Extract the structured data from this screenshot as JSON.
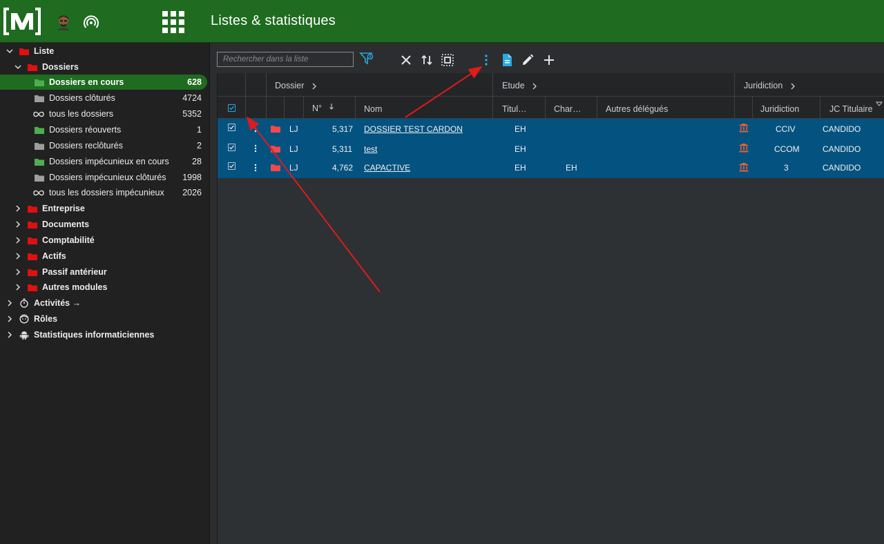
{
  "header": {
    "title": "Listes & statistiques",
    "brand_color": "#1f6b1f"
  },
  "sidebar": {
    "root": {
      "label": "Liste"
    },
    "dossiers": {
      "label": "Dossiers",
      "items": [
        {
          "label": "Dossiers en cours",
          "count": "628",
          "icon": "folder-green",
          "selected": true
        },
        {
          "label": "Dossiers clôturés",
          "count": "4724",
          "icon": "folder-gray"
        },
        {
          "label": "tous les dossiers",
          "count": "5352",
          "icon": "infinity-icon"
        },
        {
          "label": "Dossiers réouverts",
          "count": "1",
          "icon": "folder-green"
        },
        {
          "label": "Dossiers reclôturés",
          "count": "2",
          "icon": "folder-gray"
        },
        {
          "label": "Dossiers impécunieux en cours",
          "count": "28",
          "icon": "folder-green"
        },
        {
          "label": "Dossiers impécunieux clôturés",
          "count": "1998",
          "icon": "folder-gray"
        },
        {
          "label": "tous les dossiers impécunieux",
          "count": "2026",
          "icon": "infinity-icon"
        }
      ]
    },
    "modules": [
      {
        "label": "Entreprise"
      },
      {
        "label": "Documents"
      },
      {
        "label": "Comptabilité"
      },
      {
        "label": "Actifs"
      },
      {
        "label": "Passif antérieur"
      },
      {
        "label": "Autres modules"
      }
    ],
    "sections": [
      {
        "label": "Activités →",
        "icon": "stopwatch-icon"
      },
      {
        "label": "Rôles",
        "icon": "face-icon"
      },
      {
        "label": "Statistiques informaticiennes",
        "icon": "android-icon"
      }
    ]
  },
  "toolbar": {
    "search_placeholder": "Rechercher dans la liste",
    "icons": [
      "filter-icon",
      "clear-icon",
      "sort-icon",
      "select-all-icon",
      "more-vert-icon",
      "document-icon",
      "edit-icon",
      "add-icon"
    ]
  },
  "table": {
    "groups": [
      "Dossier",
      "Etude",
      "Juridiction"
    ],
    "columns": {
      "numero": "N°",
      "nom": "Nom",
      "titulaire": "Titul…",
      "charge": "Char…",
      "autres": "Autres délégués",
      "juridiction": "Juridiction",
      "jc_titulaire": "JC Titulaire"
    },
    "rows": [
      {
        "type": "LJ",
        "numero": "5,317",
        "nom": "DOSSIER TEST CARDON",
        "titulaire": "EH",
        "charge": "",
        "juridiction": "CCIV",
        "jc": "CANDIDO"
      },
      {
        "type": "LJ",
        "numero": "5,311",
        "nom": "test",
        "titulaire": "EH",
        "charge": "",
        "juridiction": "CCOM",
        "jc": "CANDIDO"
      },
      {
        "type": "LJ",
        "numero": "4,762",
        "nom": "CAPACTIVE",
        "titulaire": "EH",
        "charge": "EH",
        "juridiction": "3",
        "jc": "CANDIDO"
      }
    ],
    "row_color": "#045280"
  }
}
